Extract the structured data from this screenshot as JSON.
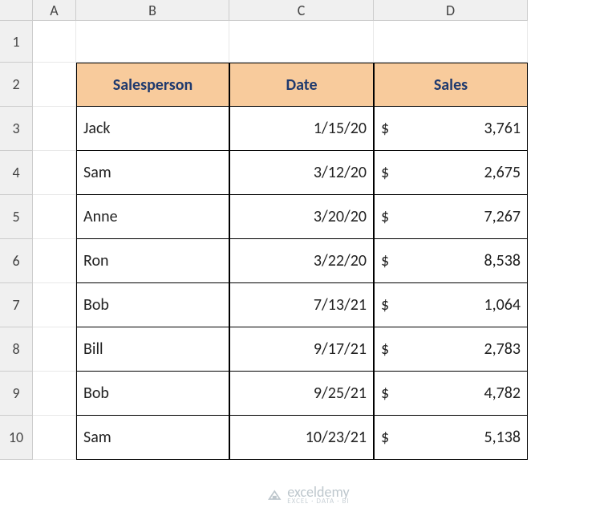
{
  "columns": [
    "A",
    "B",
    "C",
    "D"
  ],
  "rows": [
    "1",
    "2",
    "3",
    "4",
    "5",
    "6",
    "7",
    "8",
    "9",
    "10"
  ],
  "table": {
    "headers": {
      "salesperson": "Salesperson",
      "date": "Date",
      "sales": "Sales"
    },
    "data": [
      {
        "salesperson": "Jack",
        "date": "1/15/20",
        "currency": "$",
        "sales": "3,761"
      },
      {
        "salesperson": "Sam",
        "date": "3/12/20",
        "currency": "$",
        "sales": "2,675"
      },
      {
        "salesperson": "Anne",
        "date": "3/20/20",
        "currency": "$",
        "sales": "7,267"
      },
      {
        "salesperson": "Ron",
        "date": "3/22/20",
        "currency": "$",
        "sales": "8,538"
      },
      {
        "salesperson": "Bob",
        "date": "7/13/21",
        "currency": "$",
        "sales": "1,064"
      },
      {
        "salesperson": "Bill",
        "date": "9/17/21",
        "currency": "$",
        "sales": "2,783"
      },
      {
        "salesperson": "Bob",
        "date": "9/25/21",
        "currency": "$",
        "sales": "4,782"
      },
      {
        "salesperson": "Sam",
        "date": "10/23/21",
        "currency": "$",
        "sales": "5,138"
      }
    ]
  },
  "watermark": {
    "brand": "exceldemy",
    "tagline": "EXCEL · DATA · BI"
  }
}
